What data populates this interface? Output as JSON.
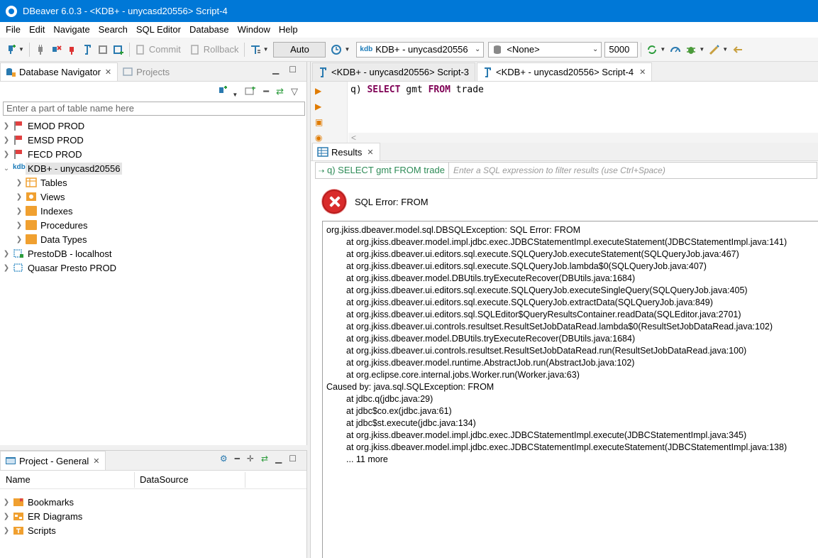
{
  "window": {
    "title": "DBeaver 6.0.3 - <KDB+ - unycasd20556> Script-4"
  },
  "menu": [
    "File",
    "Edit",
    "Navigate",
    "Search",
    "SQL Editor",
    "Database",
    "Window",
    "Help"
  ],
  "toolbar": {
    "commit_label": "Commit",
    "rollback_label": "Rollback",
    "auto_label": "Auto",
    "datasource_value": "KDB+ - unycasd20556",
    "schema_value": "<None>",
    "limit_value": "5000"
  },
  "navigator": {
    "tab_label": "Database Navigator",
    "projects_tab_label": "Projects",
    "filter_placeholder": "Enter a part of table name here",
    "items": [
      {
        "label": "EMOD PROD"
      },
      {
        "label": "EMSD PROD"
      },
      {
        "label": "FECD PROD"
      },
      {
        "label": "KDB+ - unycasd20556"
      },
      {
        "label": "Tables"
      },
      {
        "label": "Views"
      },
      {
        "label": "Indexes"
      },
      {
        "label": "Procedures"
      },
      {
        "label": "Data Types"
      },
      {
        "label": "PrestoDB - localhost"
      },
      {
        "label": "Quasar Presto PROD"
      }
    ]
  },
  "project": {
    "tab_label": "Project - General",
    "col_name": "Name",
    "col_datasource": "DataSource",
    "items": [
      {
        "label": "Bookmarks"
      },
      {
        "label": "ER Diagrams"
      },
      {
        "label": "Scripts"
      }
    ]
  },
  "editor": {
    "tabs": [
      {
        "label": "<KDB+ - unycasd20556> Script-3"
      },
      {
        "label": "<KDB+ - unycasd20556> Script-4"
      }
    ],
    "code": {
      "prefix": "q)",
      "kw1": "SELECT",
      "mid": "gmt",
      "kw2": "FROM",
      "rest": "trade"
    },
    "scroll_glyph": "<"
  },
  "results": {
    "tab_label": "Results",
    "query_text": "q) SELECT gmt FROM trade",
    "filter_placeholder": "Enter a SQL expression to filter results (use Ctrl+Space)",
    "error_title": "SQL Error: FROM",
    "trace": [
      {
        "text": "org.jkiss.dbeaver.model.sql.DBSQLException: SQL Error: FROM",
        "indent": false
      },
      {
        "text": "at org.jkiss.dbeaver.model.impl.jdbc.exec.JDBCStatementImpl.executeStatement(JDBCStatementImpl.java:141)",
        "indent": true
      },
      {
        "text": "at org.jkiss.dbeaver.ui.editors.sql.execute.SQLQueryJob.executeStatement(SQLQueryJob.java:467)",
        "indent": true
      },
      {
        "text": "at org.jkiss.dbeaver.ui.editors.sql.execute.SQLQueryJob.lambda$0(SQLQueryJob.java:407)",
        "indent": true
      },
      {
        "text": "at org.jkiss.dbeaver.model.DBUtils.tryExecuteRecover(DBUtils.java:1684)",
        "indent": true
      },
      {
        "text": "at org.jkiss.dbeaver.ui.editors.sql.execute.SQLQueryJob.executeSingleQuery(SQLQueryJob.java:405)",
        "indent": true
      },
      {
        "text": "at org.jkiss.dbeaver.ui.editors.sql.execute.SQLQueryJob.extractData(SQLQueryJob.java:849)",
        "indent": true
      },
      {
        "text": "at org.jkiss.dbeaver.ui.editors.sql.SQLEditor$QueryResultsContainer.readData(SQLEditor.java:2701)",
        "indent": true
      },
      {
        "text": "at org.jkiss.dbeaver.ui.controls.resultset.ResultSetJobDataRead.lambda$0(ResultSetJobDataRead.java:102)",
        "indent": true
      },
      {
        "text": "at org.jkiss.dbeaver.model.DBUtils.tryExecuteRecover(DBUtils.java:1684)",
        "indent": true
      },
      {
        "text": "at org.jkiss.dbeaver.ui.controls.resultset.ResultSetJobDataRead.run(ResultSetJobDataRead.java:100)",
        "indent": true
      },
      {
        "text": "at org.jkiss.dbeaver.model.runtime.AbstractJob.run(AbstractJob.java:102)",
        "indent": true
      },
      {
        "text": "at org.eclipse.core.internal.jobs.Worker.run(Worker.java:63)",
        "indent": true
      },
      {
        "text": "Caused by: java.sql.SQLException: FROM",
        "indent": false
      },
      {
        "text": "at jdbc.q(jdbc.java:29)",
        "indent": true
      },
      {
        "text": "at jdbc$co.ex(jdbc.java:61)",
        "indent": true
      },
      {
        "text": "at jdbc$st.execute(jdbc.java:134)",
        "indent": true
      },
      {
        "text": "at org.jkiss.dbeaver.model.impl.jdbc.exec.JDBCStatementImpl.execute(JDBCStatementImpl.java:345)",
        "indent": true
      },
      {
        "text": "at org.jkiss.dbeaver.model.impl.jdbc.exec.JDBCStatementImpl.executeStatement(JDBCStatementImpl.java:138)",
        "indent": true
      },
      {
        "text": "... 11 more",
        "indent": true
      }
    ]
  },
  "colors": {
    "titlebar": "#0078d7",
    "keyword": "#7f0055",
    "query_green": "#2e8b57",
    "error_red": "#d92b2b",
    "folder": "#f0a030"
  }
}
